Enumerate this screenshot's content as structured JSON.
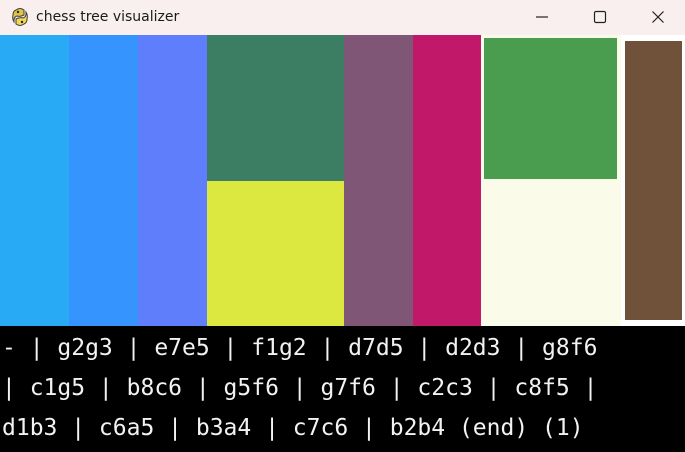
{
  "window": {
    "title": "chess tree visualizer",
    "app_icon": "python-snake-icon",
    "controls": {
      "minimize_icon": "minimize-icon",
      "maximize_icon": "maximize-icon",
      "close_icon": "close-icon"
    }
  },
  "tree": {
    "colors": {
      "node_1": "#29aaf5",
      "node_2": "#3594fd",
      "node_3": "#5e7efb",
      "node_4_top": "#3b7e63",
      "node_4_bottom": "#dce840",
      "node_5": "#7f5676",
      "node_6": "#c2186a",
      "node_7_top": "#4a9c4f",
      "node_7_bottom": "#fafbe8",
      "node_8": "#70523a",
      "background": "#ffffff"
    }
  },
  "moves": {
    "line1": "- | g2g3 | e7e5 | f1g2 | d7d5 | d2d3 | g8f6",
    "line2": "| c1g5 | b8c6 | g5f6 | g7f6 | c2c3 | c8f5 |",
    "line3": "d1b3 | c6a5 | b3a4 | c7c6 | b2b4 (end) (1)"
  }
}
